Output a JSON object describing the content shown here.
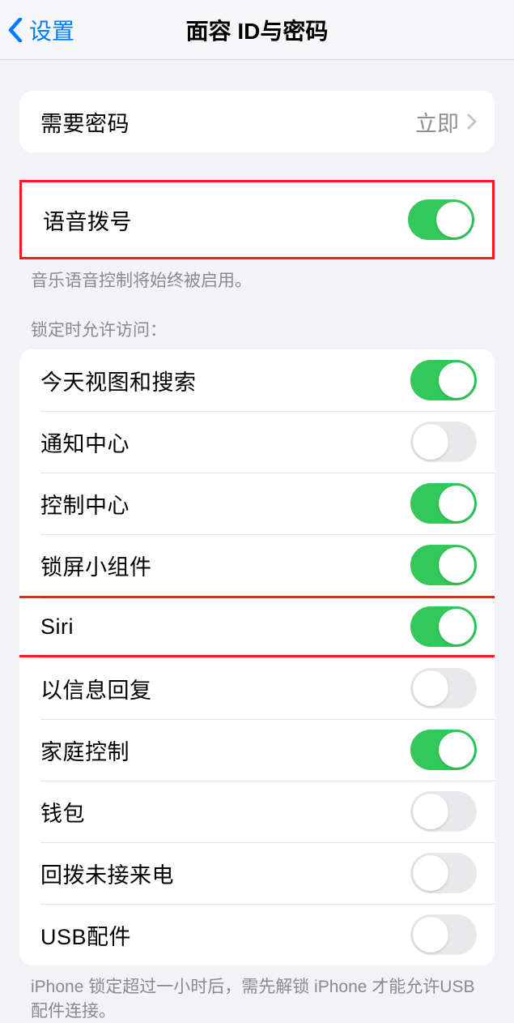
{
  "nav": {
    "back_label": "设置",
    "title": "面容 ID与密码"
  },
  "require_passcode": {
    "label": "需要密码",
    "value": "立即"
  },
  "voice_dial": {
    "label": "语音拨号",
    "on": true,
    "footer": "音乐语音控制将始终被启用。"
  },
  "access_header": "锁定时允许访问：",
  "access_items": [
    {
      "label": "今天视图和搜索",
      "on": true
    },
    {
      "label": "通知中心",
      "on": false
    },
    {
      "label": "控制中心",
      "on": true
    },
    {
      "label": "锁屏小组件",
      "on": true
    },
    {
      "label": "Siri",
      "on": true
    },
    {
      "label": "以信息回复",
      "on": false
    },
    {
      "label": "家庭控制",
      "on": true
    },
    {
      "label": "钱包",
      "on": false
    },
    {
      "label": "回拨未接来电",
      "on": false
    },
    {
      "label": "USB配件",
      "on": false
    }
  ],
  "usb_footer": "iPhone 锁定超过一小时后，需先解锁 iPhone 才能允许USB 配件连接。"
}
